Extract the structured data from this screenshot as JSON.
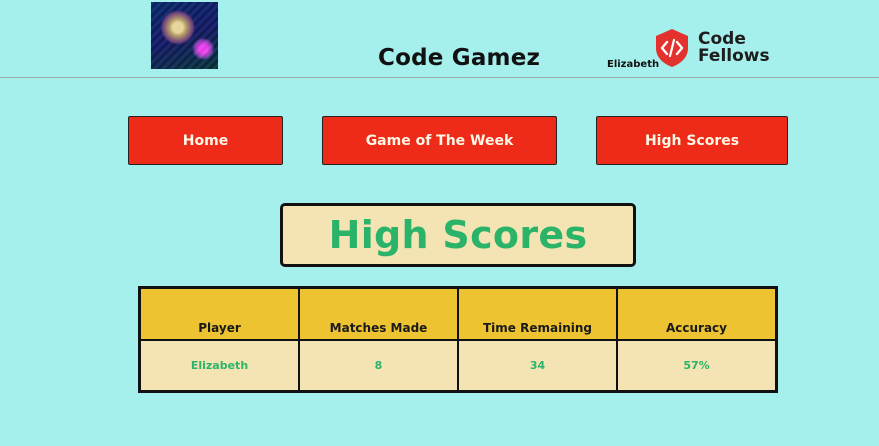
{
  "header": {
    "site_title": "Code Gamez",
    "user_name": "Elizabeth",
    "brand_line1": "Code",
    "brand_line2": "Fellows",
    "brand_color": "#e3322e"
  },
  "nav": {
    "items": [
      {
        "label": "Home"
      },
      {
        "label": "Game of The Week"
      },
      {
        "label": "High Scores"
      }
    ],
    "color": "#ee2a18"
  },
  "main": {
    "heading": "High Scores",
    "table": {
      "columns": [
        "Player",
        "Matches Made",
        "Time Remaining",
        "Accuracy"
      ],
      "rows": [
        [
          "Elizabeth",
          "8",
          "34",
          "57%"
        ]
      ]
    }
  },
  "colors": {
    "background": "#a5efec",
    "heading_text": "#2bb36a",
    "header_cell": "#eec331",
    "body_cell": "#f4e4b4"
  }
}
